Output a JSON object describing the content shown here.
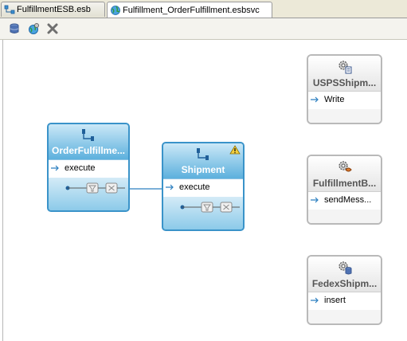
{
  "tabs": [
    {
      "label": "FulfillmentESB.esb",
      "active": false
    },
    {
      "label": "Fulfillment_OrderFulfillment.esbsvc",
      "active": true
    }
  ],
  "toolbar": {
    "icons": [
      "database-icon",
      "globe-gear-icon",
      "delete-icon"
    ]
  },
  "nodes": {
    "order": {
      "title": "OrderFulfillme...",
      "operation": "execute"
    },
    "shipment": {
      "title": "Shipment",
      "operation": "execute",
      "warning": true
    }
  },
  "refs": {
    "usps": {
      "title": "USPSShipm...",
      "operation": "Write"
    },
    "fulfillmentb": {
      "title": "FulfillmentB...",
      "operation": "sendMess..."
    },
    "fedex": {
      "title": "FedexShipm...",
      "operation": "insert"
    }
  },
  "colors": {
    "node_border": "#3a93c9",
    "node_fill": "#7fc0e4",
    "connector": "#2c7fc0",
    "ref_border": "#b9b9b9"
  }
}
